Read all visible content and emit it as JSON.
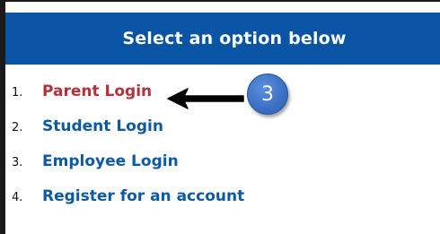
{
  "header": {
    "title": "Select an option below"
  },
  "options": [
    {
      "number": "1.",
      "label": "Parent Login",
      "color": "#b3313a"
    },
    {
      "number": "2.",
      "label": "Student Login",
      "color": "#0c5aa6"
    },
    {
      "number": "3.",
      "label": "Employee Login",
      "color": "#0c5aa6"
    },
    {
      "number": "4.",
      "label": "Register for an account",
      "color": "#0c5aa6"
    }
  ],
  "annotation": {
    "arrow_icon": "arrow-left-icon",
    "step_badge": "3",
    "badge_color": "#3a6fc4"
  },
  "colors": {
    "header_bg": "#0954a5",
    "header_text": "#ffffff"
  }
}
